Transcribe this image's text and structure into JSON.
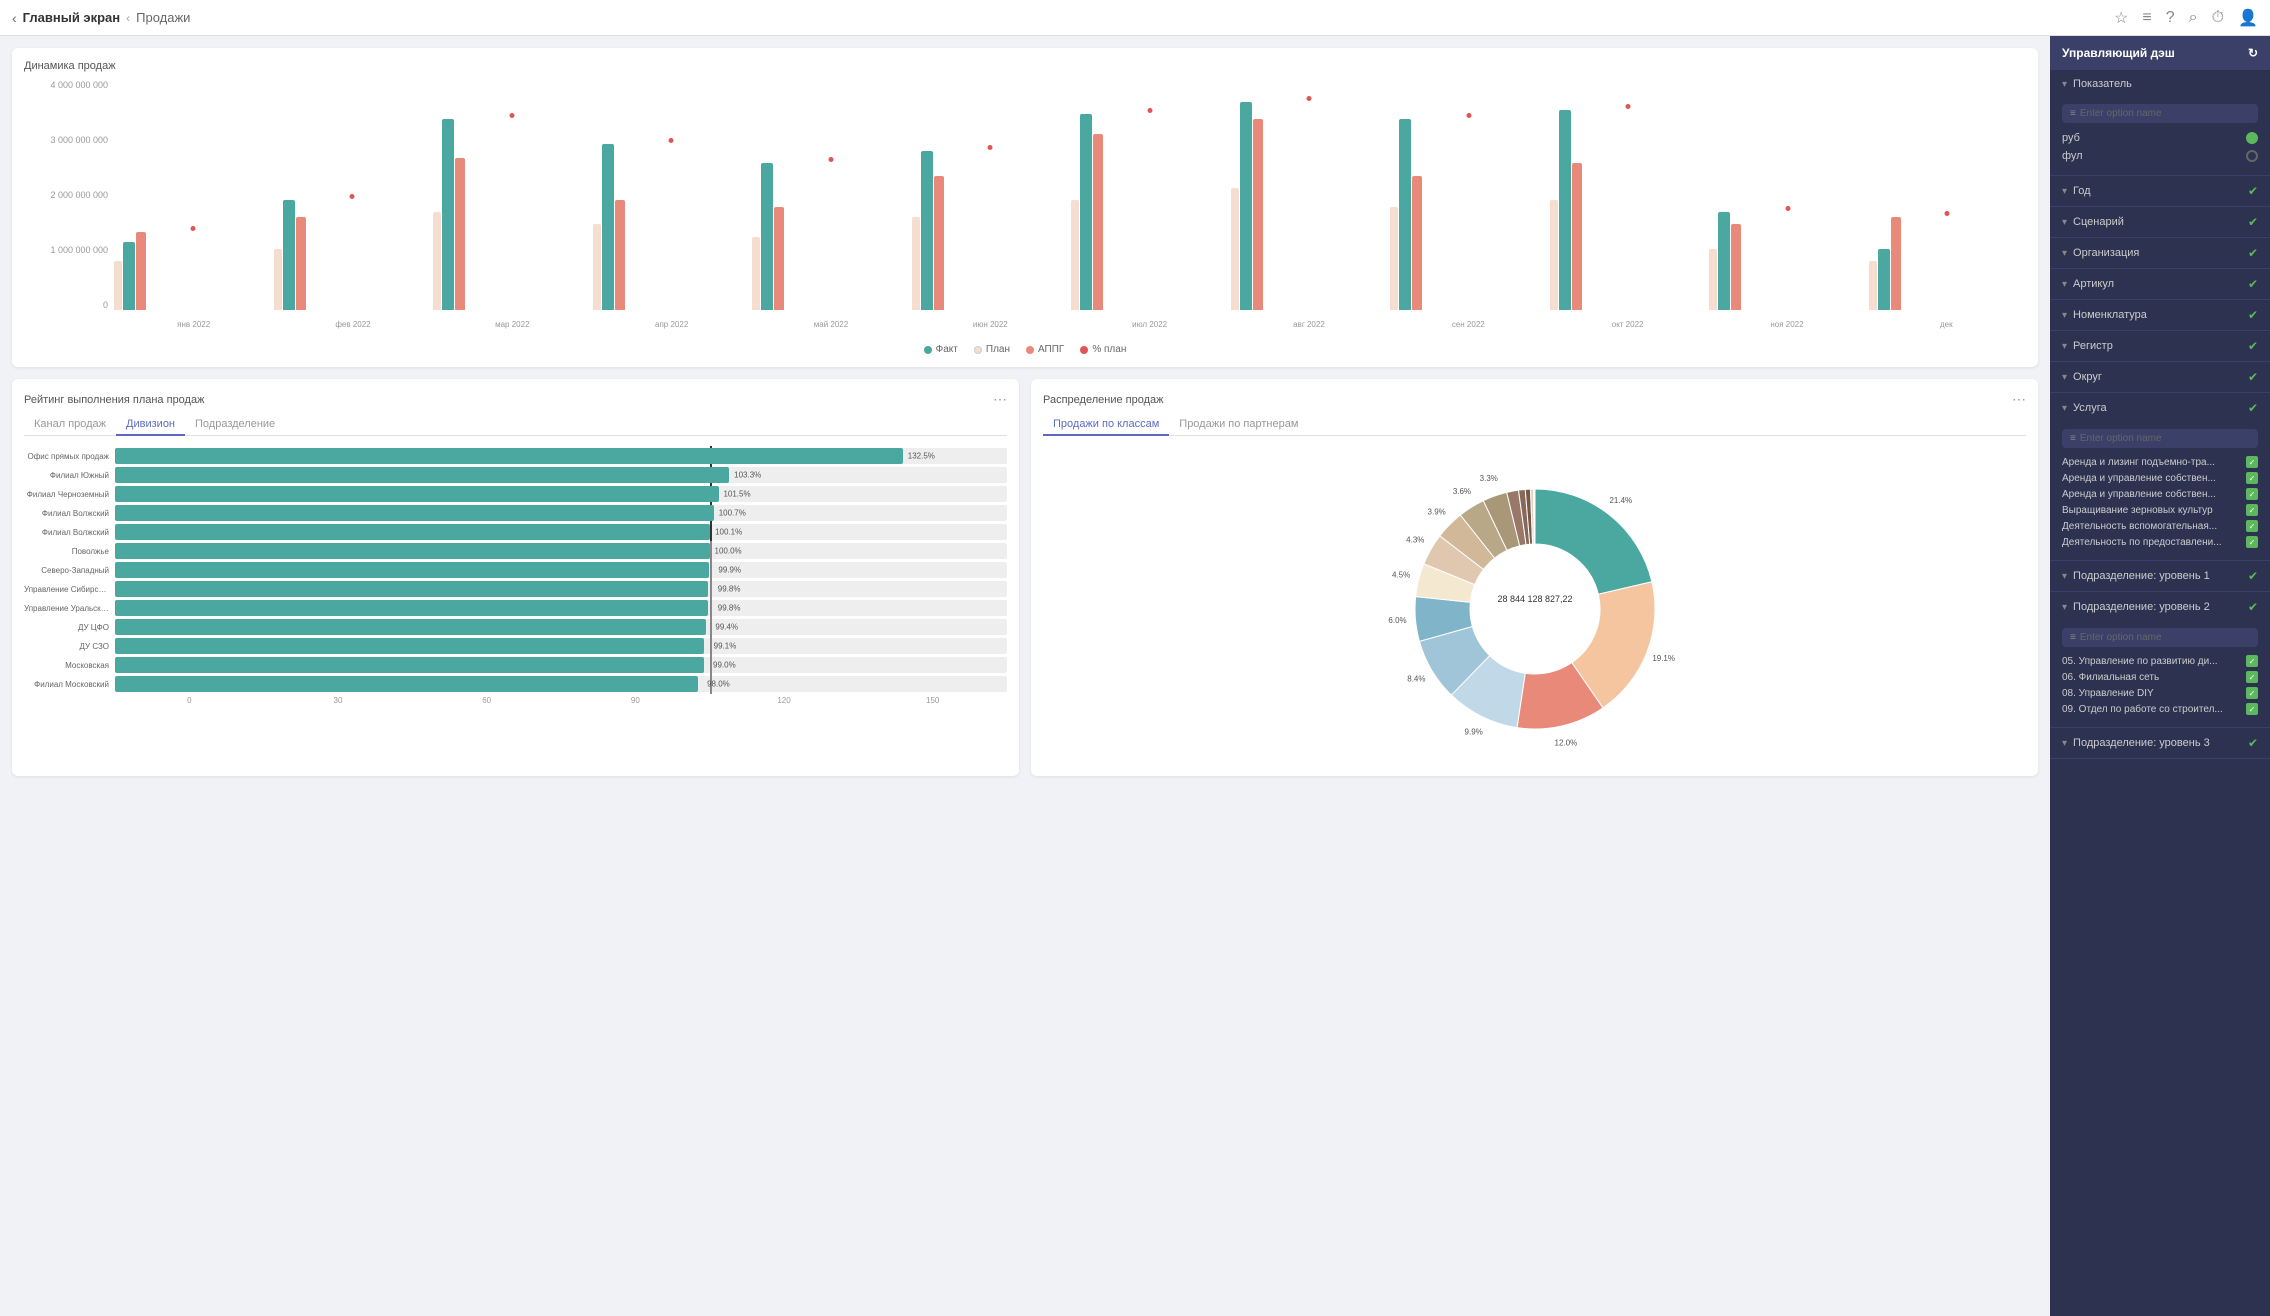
{
  "topbar": {
    "back_label": "‹",
    "home_label": "Главный экран",
    "sep": "‹",
    "current_label": "Продажи",
    "icons": [
      "★",
      "≡",
      "?",
      "🔍",
      "⏱",
      "👤"
    ]
  },
  "charts": {
    "top": {
      "title": "Динамика продаж",
      "y_labels": [
        "4 000 000 000",
        "3 000 000 000",
        "2 000 000 000",
        "1 000 000 000",
        "0"
      ],
      "months": [
        "янв 2022",
        "фев 2022",
        "мар 2022",
        "апр 2022",
        "май 2022",
        "июн 2022",
        "июл 2022",
        "авг 2022",
        "сен 2022",
        "окт 2022",
        "ноя 2022",
        "дек"
      ],
      "bars": [
        {
          "teal": 28,
          "pink": 32,
          "cream": 20
        },
        {
          "teal": 45,
          "pink": 38,
          "cream": 25
        },
        {
          "teal": 78,
          "pink": 62,
          "cream": 40
        },
        {
          "teal": 68,
          "pink": 45,
          "cream": 35
        },
        {
          "teal": 60,
          "pink": 42,
          "cream": 30
        },
        {
          "teal": 65,
          "pink": 55,
          "cream": 38
        },
        {
          "teal": 80,
          "pink": 72,
          "cream": 45
        },
        {
          "teal": 85,
          "pink": 78,
          "cream": 50
        },
        {
          "teal": 78,
          "pink": 55,
          "cream": 42
        },
        {
          "teal": 82,
          "pink": 60,
          "cream": 45
        },
        {
          "teal": 40,
          "pink": 35,
          "cream": 25
        },
        {
          "teal": 25,
          "pink": 38,
          "cream": 20
        }
      ],
      "legend": [
        {
          "label": "Факт",
          "type": "dot",
          "color": "#4aa8a0"
        },
        {
          "label": "План",
          "type": "line",
          "color": "#f5ddd0"
        },
        {
          "label": "АППГ",
          "type": "dot",
          "color": "#e8897a"
        },
        {
          "label": "% план",
          "type": "dot",
          "color": "#e05555"
        }
      ]
    },
    "rating": {
      "title": "Рейтинг выполнения плана продаж",
      "tabs": [
        "Канал продаж",
        "Дивизион",
        "Подразделение"
      ],
      "active_tab": 1,
      "more_icon": "⋯",
      "rows": [
        {
          "label": "Офис прямых продаж",
          "value": 132.5,
          "pct": 88
        },
        {
          "label": "Филиал Южный",
          "value": 103.3,
          "pct": 69
        },
        {
          "label": "Филиал Черноземный",
          "value": 101.5,
          "pct": 68
        },
        {
          "label": "Филиал Волжский",
          "value": 100.7,
          "pct": 67
        },
        {
          "label": "Филиал Волжский",
          "value": 100.1,
          "pct": 67
        },
        {
          "label": "Поволжье",
          "value": 100.0,
          "pct": 67
        },
        {
          "label": "Северо-Западный",
          "value": 99.9,
          "pct": 66
        },
        {
          "label": "Управление Сибирское",
          "value": 99.8,
          "pct": 66
        },
        {
          "label": "Управление Уральское",
          "value": 99.8,
          "pct": 66
        },
        {
          "label": "ДУ ЦФО",
          "value": 99.4,
          "pct": 66
        },
        {
          "label": "ДУ СЗО",
          "value": 99.1,
          "pct": 66
        },
        {
          "label": "Московская",
          "value": 99.0,
          "pct": 66
        },
        {
          "label": "Филиал Московский",
          "value": 98.0,
          "pct": 65
        }
      ],
      "axis_labels": [
        "0",
        "30",
        "60",
        "90",
        "120",
        "150"
      ],
      "marker_pos_pct": 66.7
    },
    "distribution": {
      "title": "Распределение продаж",
      "tabs": [
        "Продажи по классам",
        "Продажи по партнерам"
      ],
      "active_tab": 0,
      "center_value": "28 844 128 827,22",
      "segments": [
        {
          "label": "21.4%",
          "value": 21.4,
          "color": "#4aa8a0"
        },
        {
          "label": "19.1%",
          "value": 19.1,
          "color": "#f5c5a0"
        },
        {
          "label": "12.0%",
          "value": 12.0,
          "color": "#e8897a"
        },
        {
          "label": "9.9%",
          "value": 9.9,
          "color": "#c0d8e8"
        },
        {
          "label": "8.4%",
          "value": 8.4,
          "color": "#a0c4d8"
        },
        {
          "label": "6.0%",
          "value": 6.0,
          "color": "#80b4c8"
        },
        {
          "label": "4.5%",
          "value": 4.5,
          "color": "#f5e8d0"
        },
        {
          "label": "4.3%",
          "value": 4.3,
          "color": "#e0c8b0"
        },
        {
          "label": "3.9%",
          "value": 3.9,
          "color": "#d0b898"
        },
        {
          "label": "3.6%",
          "value": 3.6,
          "color": "#b8a888"
        },
        {
          "label": "3.3%",
          "value": 3.3,
          "color": "#a89878"
        },
        {
          "label": "1.6%",
          "value": 1.6,
          "color": "#987868"
        },
        {
          "label": "0.9%",
          "value": 0.9,
          "color": "#886858"
        },
        {
          "label": "0.7%",
          "value": 0.7,
          "color": "#785848"
        },
        {
          "label": "0.4%",
          "value": 0.4,
          "color": "#e8d0c0"
        },
        {
          "label": "0.0%",
          "value": 0.1,
          "color": "#d8c0b0"
        },
        {
          "label": "0.0%",
          "value": 0.1,
          "color": "#c8b0a0"
        }
      ]
    }
  },
  "right_panel": {
    "title": "Управляющий дэш",
    "collapse_icon": "↻",
    "sections": [
      {
        "id": "показатель",
        "label": "Показатель",
        "expanded": true,
        "has_check": false,
        "search_placeholder": "Enter option name",
        "options": [
          {
            "label": "руб",
            "selected": true
          },
          {
            "label": "фул",
            "selected": false
          }
        ]
      },
      {
        "id": "год",
        "label": "Год",
        "expanded": false,
        "has_check": true
      },
      {
        "id": "сценарий",
        "label": "Сценарий",
        "expanded": false,
        "has_check": true
      },
      {
        "id": "организация",
        "label": "Организация",
        "expanded": false,
        "has_check": true
      },
      {
        "id": "артикул",
        "label": "Артикул",
        "expanded": false,
        "has_check": true
      },
      {
        "id": "номенклатура",
        "label": "Номенклатура",
        "expanded": false,
        "has_check": true
      },
      {
        "id": "регистр",
        "label": "Регистр",
        "expanded": false,
        "has_check": true
      },
      {
        "id": "округ",
        "label": "Округ",
        "expanded": false,
        "has_check": true
      },
      {
        "id": "услуга",
        "label": "Услуга",
        "expanded": true,
        "has_check": true,
        "search_placeholder": "Enter option name",
        "items": [
          "Аренда и лизинг подъемно-тра...",
          "Аренда и управление собствен...",
          "Аренда и управление собствен...",
          "Выращивание зерновых культур",
          "Деятельность вспомогательная...",
          "Деятельность по предоставлени..."
        ]
      },
      {
        "id": "подразделение_1",
        "label": "Подразделение: уровень 1",
        "expanded": false,
        "has_check": true
      },
      {
        "id": "подразделение_2",
        "label": "Подразделение: уровень 2",
        "expanded": true,
        "has_check": true,
        "search_placeholder": "Enter option name",
        "items": [
          "05. Управление по развитию ди...",
          "06. Филиальная сеть",
          "08. Управление DIY",
          "09. Отдел по работе со строител..."
        ]
      },
      {
        "id": "подразделение_3",
        "label": "Подразделение: уровень 3",
        "expanded": false,
        "has_check": true
      }
    ]
  }
}
